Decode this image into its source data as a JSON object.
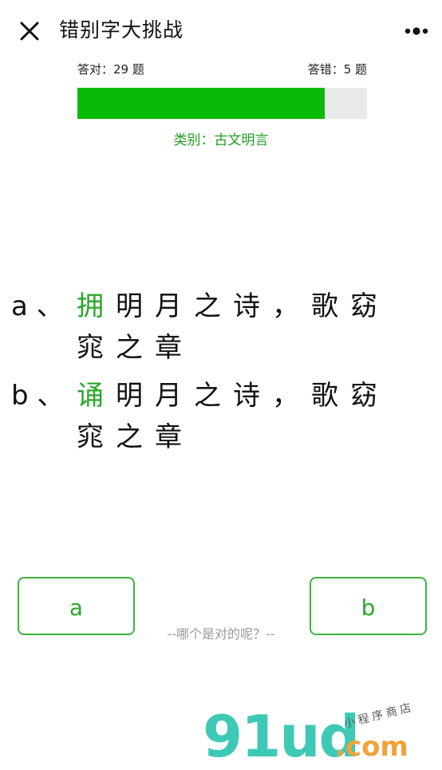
{
  "header": {
    "title": "错别字大挑战"
  },
  "stats": {
    "correct_label": "答对：29 题",
    "wrong_label": "答错：5 题",
    "correct": 29,
    "wrong": 5,
    "progress_fraction": 0.853
  },
  "category": {
    "label": "类别：",
    "value": "古文明言"
  },
  "options": [
    {
      "letter": "a 、",
      "highlight": "拥",
      "rest": "明月之诗，歌窈窕之章"
    },
    {
      "letter": "b 、",
      "highlight": "诵",
      "rest": "明月之诗，歌窈窕之章"
    }
  ],
  "buttons": {
    "a_label": "a",
    "b_label": "b"
  },
  "hint": "--哪个是对的呢？--",
  "watermark": {
    "main": "91ud",
    "com": ".com",
    "sub": "小程序商店"
  },
  "colors": {
    "accent": "#09bb07",
    "accent_text": "#2aa72a",
    "track": "#e9e9e9",
    "hint": "#9a9a9a"
  },
  "icons": {
    "close": "close-icon",
    "more": "more-icon"
  }
}
